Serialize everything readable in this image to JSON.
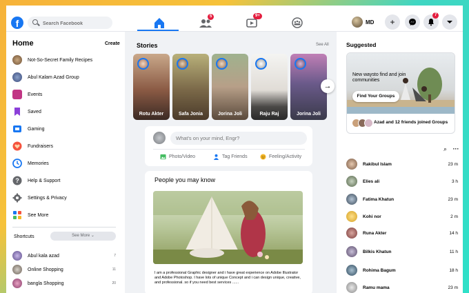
{
  "search": {
    "placeholder": "Search Facebook"
  },
  "nav": {
    "friends_badge": "5",
    "watch_badge": "9+",
    "notif_badge": "7",
    "profile_name": "MD"
  },
  "left": {
    "title": "Home",
    "create": "Create",
    "items": [
      {
        "label": "Not-So-Secret Family Recipes",
        "icon": "family-recipes-avatar",
        "color": "#8a6a4a"
      },
      {
        "label": "Abul Kalam Azad Group",
        "icon": "group-avatar",
        "color": "#4a5a8a"
      },
      {
        "label": "Events",
        "icon": "events-icon",
        "color": "#c13584"
      },
      {
        "label": "Saved",
        "icon": "saved-icon",
        "color": "#8b3fd9"
      },
      {
        "label": "Gaming",
        "icon": "gaming-icon",
        "color": "#1877f2"
      },
      {
        "label": "Fundraisers",
        "icon": "fundraisers-icon",
        "color": "#f5533d"
      },
      {
        "label": "Memories",
        "icon": "memories-icon",
        "color": "#1877f2"
      },
      {
        "label": "Help & Support",
        "icon": "help-icon",
        "color": "#65676b"
      },
      {
        "label": "Settings & Privacy",
        "icon": "settings-icon",
        "color": "#65676b"
      },
      {
        "label": "See More",
        "icon": "see-more-icon",
        "color": "#1877f2"
      }
    ],
    "shortcuts_title": "Shortcuts",
    "see_more_btn": "See More",
    "shortcuts": [
      {
        "label": "Abul kala azad",
        "count": "7"
      },
      {
        "label": "Online Shopping",
        "count": "11"
      },
      {
        "label": "bangla Shopping",
        "count": "20"
      }
    ]
  },
  "center": {
    "stories_title": "Stories",
    "see_all": "See All",
    "stories": [
      {
        "name": "Rotu Akter"
      },
      {
        "name": "Safa Jonia"
      },
      {
        "name": "Jorina Joli"
      },
      {
        "name": "Raju Raj"
      },
      {
        "name": "Jorina Joli"
      }
    ],
    "post_placeholder": "What's on your mind, Engr?",
    "actions": [
      "Photo/Video",
      "Tag Friends",
      "Feeling/Activity"
    ],
    "pymk_title": "People you may know",
    "pymk_desc": "I am a professional Graphic designer and i have great experience on Adobe Illustrator and Adobe Photoshop. I have lots of unique Concept and i can design unique, creative, and professional. so if you need best services ......"
  },
  "right": {
    "suggested_title": "Suggested",
    "card_text": "New waysto find and join communities",
    "find_btn": "Find Your Groups",
    "joined_text": "Azad and 12 friends joined Groups",
    "contacts": [
      {
        "name": "Rakibul Islam",
        "time": "23 m"
      },
      {
        "name": "Elies ali",
        "time": "3 h"
      },
      {
        "name": "Fatima Khatun",
        "time": "23 m"
      },
      {
        "name": "Kohi nor",
        "time": "2 m"
      },
      {
        "name": "Runa Akter",
        "time": "14 h"
      },
      {
        "name": "Bilkis Khatun",
        "time": "11 h"
      },
      {
        "name": "Rohima Bagum",
        "time": "18 h"
      },
      {
        "name": "Ramu mama",
        "time": "23 m"
      }
    ]
  }
}
